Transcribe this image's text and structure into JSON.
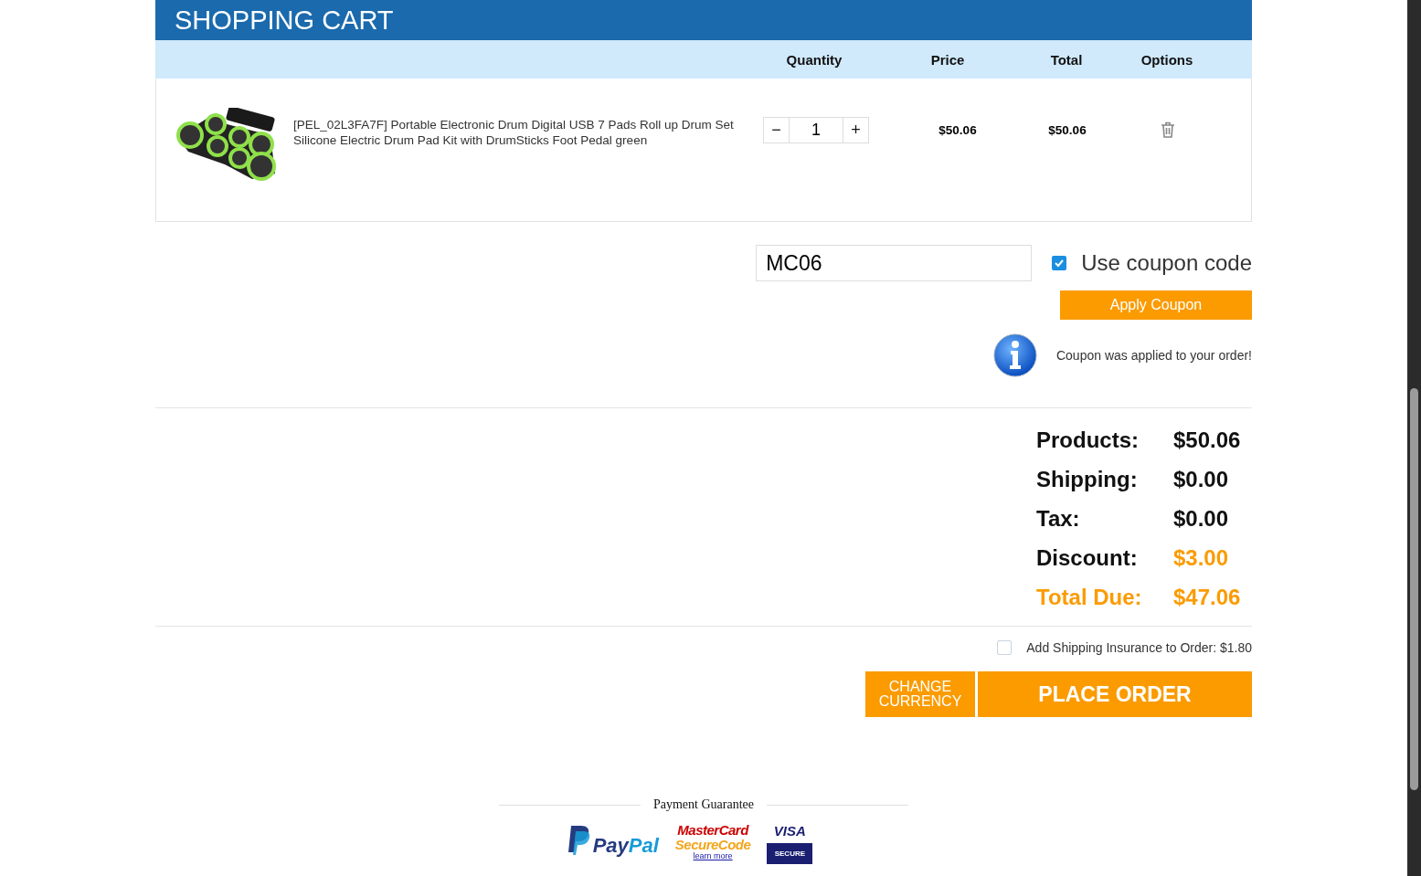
{
  "cart": {
    "title": "SHOPPING CART",
    "columns": [
      "Quantity",
      "Price",
      "Total",
      "Options"
    ],
    "items": [
      {
        "name": "[PEL_02L3FA7F] Portable Electronic Drum Digital USB 7 Pads Roll up Drum Set Silicone Electric Drum Pad Kit with DrumSticks Foot Pedal green",
        "quantity": "1",
        "minus": "−",
        "plus": "+",
        "price": "$50.06",
        "total": "$50.06"
      }
    ]
  },
  "coupon": {
    "value": "MC06",
    "use_label": "Use coupon code",
    "checked": true,
    "apply_button": "Apply Coupon",
    "message": "Coupon was applied to your order!"
  },
  "totals": [
    {
      "label": "Products:",
      "value": "$50.06",
      "kind": "plain"
    },
    {
      "label": "Shipping:",
      "value": "$0.00",
      "kind": "plain"
    },
    {
      "label": "Tax:",
      "value": "$0.00",
      "kind": "plain"
    },
    {
      "label": "Discount:",
      "value": "$3.00",
      "kind": "discount"
    },
    {
      "label": "Total Due:",
      "value": "$47.06",
      "kind": "grand_total"
    }
  ],
  "insurance": {
    "label": "Add Shipping Insurance to Order: $1.80",
    "checked": false
  },
  "buttons": {
    "change_currency": "CHANGE CURRENCY",
    "place_order": "PLACE ORDER"
  },
  "footer": {
    "title": "Payment Guarantee",
    "paypal": [
      "Pay",
      "Pal"
    ],
    "mastercard": [
      "MasterCard",
      "SecureCode"
    ],
    "learn_more": "learn more",
    "visa": "VISA",
    "visa_secure": "SECURE"
  }
}
